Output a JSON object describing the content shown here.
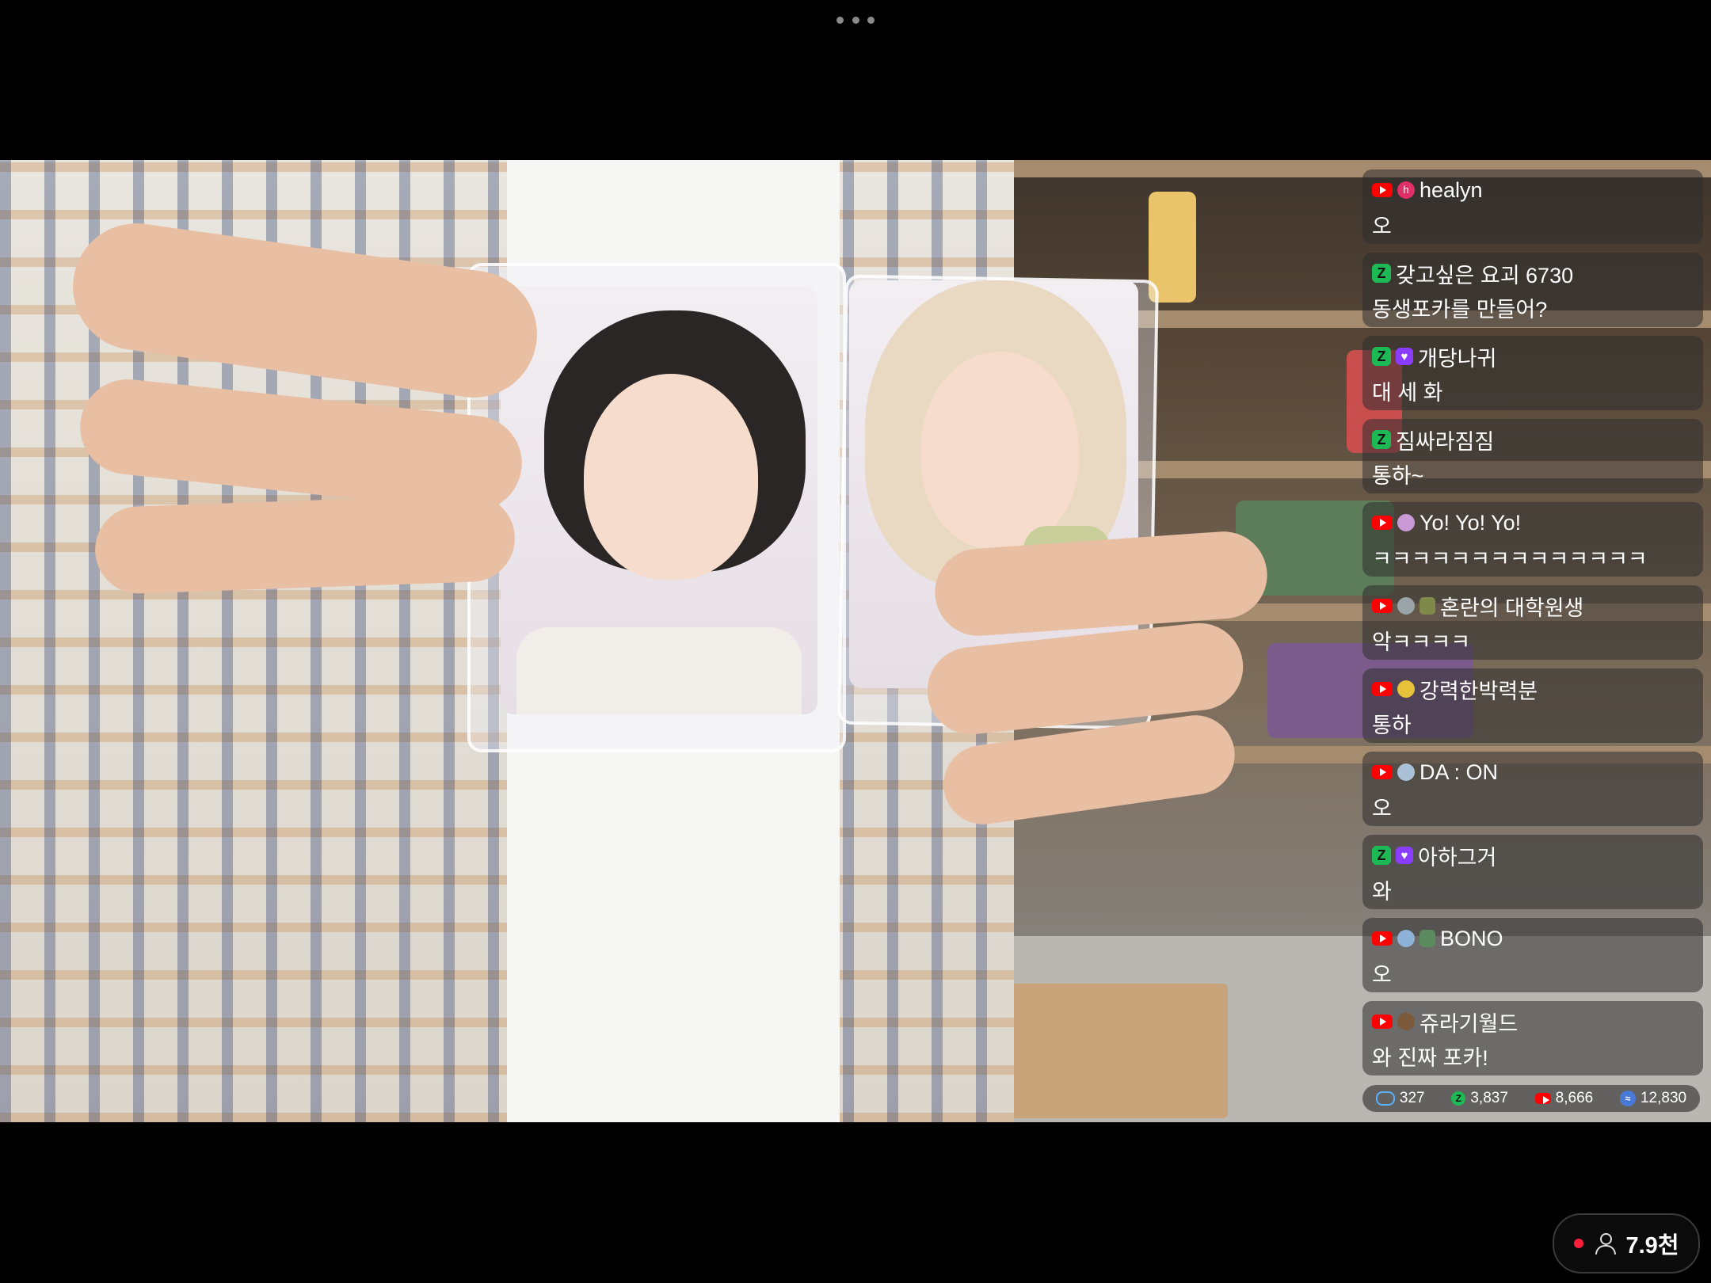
{
  "chat": {
    "messages": [
      {
        "platform": "youtube",
        "user": "healyn",
        "text": "오",
        "avatar_letter": "h"
      },
      {
        "platform": "chzzk",
        "user": "갖고싶은 요괴 6730",
        "text": "동생포카를 만들어?"
      },
      {
        "platform": "chzzk",
        "user": "개당나귀",
        "text": "대 세 화"
      },
      {
        "platform": "chzzk",
        "user": "짐싸라짐짐",
        "text": "통하~"
      },
      {
        "platform": "youtube",
        "user": "Yo! Yo! Yo!",
        "text": "ㅋㅋㅋㅋㅋㅋㅋㅋㅋㅋㅋㅋㅋㅋ"
      },
      {
        "platform": "youtube",
        "user": "혼란의 대학원생",
        "text": "악ㅋㅋㅋㅋ"
      },
      {
        "platform": "youtube",
        "user": "강력한박력분",
        "text": "통하"
      },
      {
        "platform": "youtube",
        "user": "DA : ON",
        "text": "오"
      },
      {
        "platform": "chzzk",
        "user": "아하그거",
        "text": "와"
      },
      {
        "platform": "youtube",
        "user": "BONO",
        "text": "오"
      },
      {
        "platform": "youtube",
        "user": "쥬라기월드",
        "text": "와 진짜 포카!"
      }
    ]
  },
  "stats": {
    "soop": "327",
    "chzzk": "3,837",
    "youtube": "8,666",
    "total": "12,830"
  },
  "viewers": {
    "count": "7.9천"
  },
  "colors": {
    "youtube": "#ff0000",
    "chzzk": "#1db954",
    "live": "#ff1f3d"
  }
}
